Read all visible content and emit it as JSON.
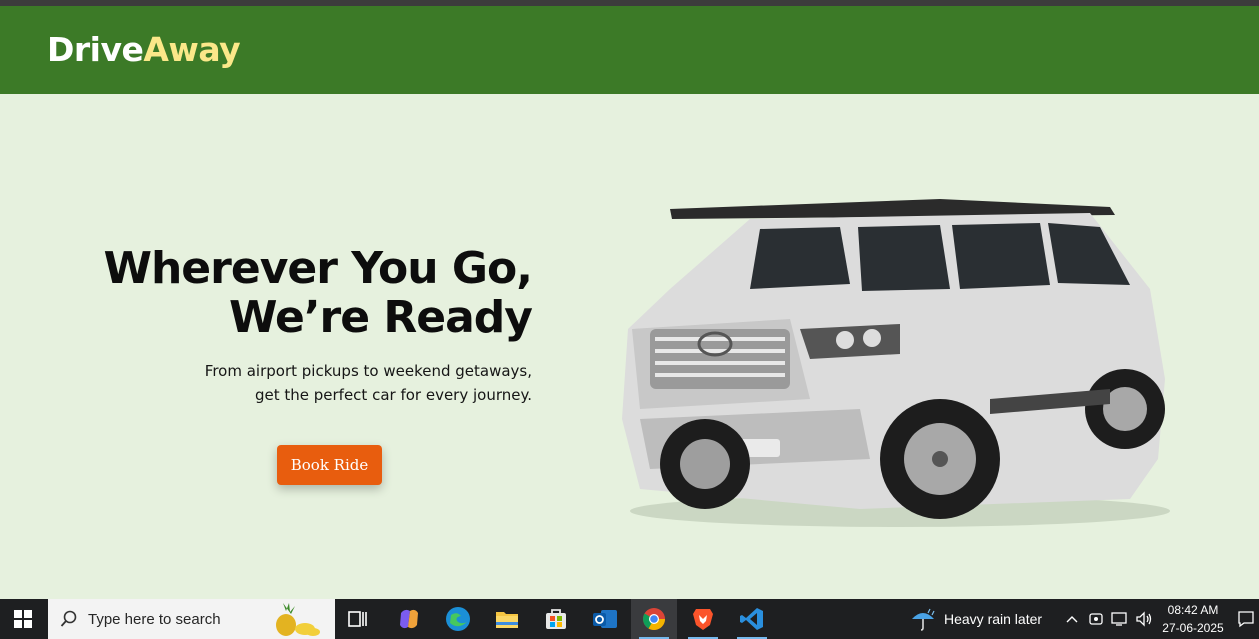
{
  "brand": {
    "part1": "Drive",
    "part2": "Away"
  },
  "hero": {
    "title_line1": "Wherever You Go,",
    "title_line2": "We’re Ready",
    "subtitle_line1": "From airport pickups to weekend getaways,",
    "subtitle_line2": "get the perfect car for every journey.",
    "cta_label": "Book Ride"
  },
  "taskbar": {
    "search_placeholder": "Type here to search",
    "weather_text": "Heavy rain later",
    "time": "08:42 AM",
    "date": "27-06-2025",
    "apps": [
      "task-view",
      "copilot",
      "edge",
      "file-explorer",
      "microsoft-store",
      "outlook",
      "chrome",
      "brave",
      "vscode"
    ]
  },
  "colors": {
    "header_bg": "#3c7a27",
    "hero_bg": "#e6f1de",
    "brand_accent": "#fbe889",
    "cta_bg": "#e85d0e",
    "taskbar_bg": "#1e1f21"
  }
}
